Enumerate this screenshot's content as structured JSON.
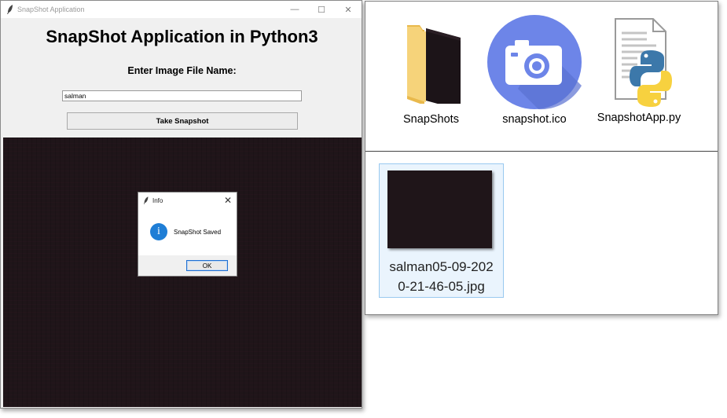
{
  "app": {
    "window_title": "SnapShot Application",
    "heading": "SnapShot Application in Python3",
    "prompt_label": "Enter Image File Name:",
    "filename_value": "salman",
    "snapshot_button": "Take Snapshot",
    "controls": {
      "minimize": "—",
      "maximize": "☐",
      "close": "✕"
    }
  },
  "dialog": {
    "title": "Info",
    "message": "SnapShot Saved",
    "ok_label": "OK",
    "close_glyph": "✕",
    "info_glyph": "i"
  },
  "explorer": {
    "items": [
      {
        "label": "SnapShots",
        "icon": "folder-icon"
      },
      {
        "label": "snapshot.ico",
        "icon": "camera-icon"
      },
      {
        "label": "SnapshotApp.py",
        "icon": "python-file-icon"
      }
    ],
    "snapshot_file": {
      "line1": "salman05-09-202",
      "line2": "0-21-46-05.jpg",
      "icon": "image-thumbnail"
    }
  },
  "colors": {
    "camera_circle": "#6d85e8",
    "info_icon": "#1f7ed6",
    "preview_bg": "#1f1519",
    "selection_bg": "#eaf4fd",
    "selection_border": "#99c9f0"
  }
}
